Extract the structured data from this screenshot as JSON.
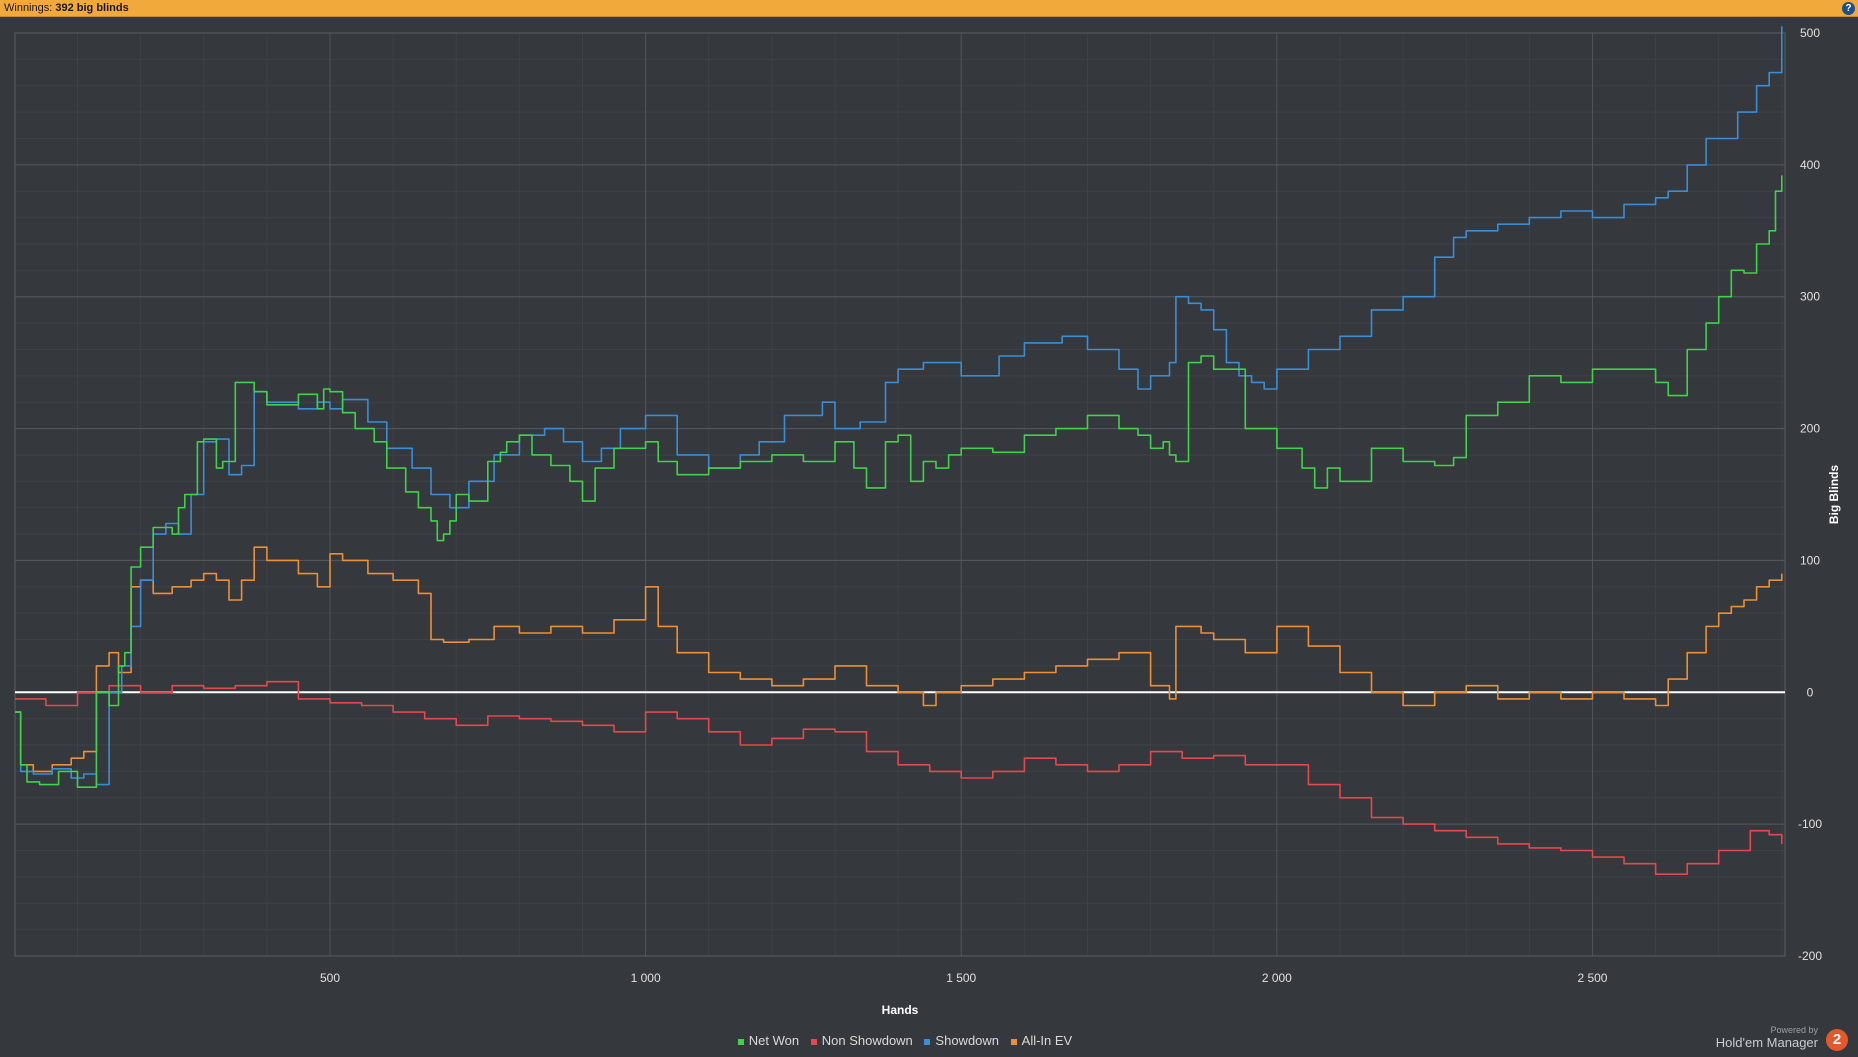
{
  "header": {
    "label": "Winnings:",
    "value": "392 big blinds",
    "help": "?"
  },
  "branding": {
    "powered": "Powered by",
    "product": "Hold'em Manager",
    "logo": "2"
  },
  "chart_data": {
    "type": "line",
    "xlabel": "Hands",
    "ylabel": "Big Blinds",
    "xlim": [
      1,
      2805
    ],
    "ylim": [
      -200,
      500
    ],
    "xticks": [
      500,
      1000,
      1500,
      2000,
      2500
    ],
    "xtick_labels": [
      "500",
      "1 000",
      "1 500",
      "2 000",
      "2 500"
    ],
    "yticks": [
      -200,
      -100,
      0,
      100,
      200,
      300,
      400,
      500
    ],
    "grid": true,
    "legend": "bottom-center",
    "series": [
      {
        "name": "Net Won",
        "color": "#3fd24a",
        "x": [
          1,
          10,
          20,
          40,
          70,
          100,
          130,
          150,
          165,
          175,
          185,
          200,
          220,
          250,
          260,
          270,
          290,
          300,
          320,
          330,
          350,
          380,
          400,
          450,
          480,
          490,
          500,
          520,
          540,
          570,
          590,
          620,
          640,
          660,
          670,
          680,
          690,
          700,
          720,
          750,
          770,
          780,
          800,
          820,
          850,
          880,
          900,
          920,
          950,
          1000,
          1020,
          1050,
          1100,
          1150,
          1200,
          1250,
          1300,
          1330,
          1350,
          1380,
          1400,
          1420,
          1440,
          1460,
          1480,
          1500,
          1550,
          1600,
          1650,
          1700,
          1750,
          1780,
          1800,
          1820,
          1830,
          1840,
          1860,
          1880,
          1900,
          1950,
          2000,
          2040,
          2060,
          2080,
          2100,
          2150,
          2200,
          2250,
          2280,
          2300,
          2350,
          2400,
          2450,
          2500,
          2550,
          2600,
          2620,
          2650,
          2680,
          2700,
          2720,
          2740,
          2760,
          2780,
          2790,
          2800
        ],
        "y": [
          -15,
          -55,
          -68,
          -70,
          -60,
          -72,
          0,
          -10,
          20,
          30,
          95,
          110,
          125,
          120,
          140,
          150,
          190,
          192,
          170,
          175,
          235,
          228,
          218,
          226,
          215,
          230,
          228,
          212,
          200,
          190,
          170,
          152,
          140,
          130,
          115,
          120,
          130,
          150,
          145,
          175,
          182,
          190,
          195,
          180,
          172,
          160,
          145,
          170,
          185,
          190,
          175,
          165,
          170,
          175,
          180,
          175,
          190,
          170,
          155,
          190,
          195,
          160,
          175,
          170,
          180,
          185,
          182,
          195,
          200,
          210,
          200,
          195,
          185,
          190,
          180,
          175,
          250,
          255,
          245,
          200,
          185,
          170,
          155,
          170,
          160,
          185,
          175,
          172,
          178,
          210,
          220,
          240,
          235,
          245,
          245,
          235,
          225,
          260,
          280,
          300,
          320,
          318,
          340,
          350,
          380,
          392
        ]
      },
      {
        "name": "Non Showdown",
        "color": "#e5484d",
        "x": [
          1,
          50,
          100,
          150,
          200,
          250,
          300,
          350,
          400,
          450,
          500,
          550,
          600,
          650,
          700,
          750,
          800,
          850,
          900,
          950,
          1000,
          1050,
          1100,
          1150,
          1200,
          1250,
          1300,
          1350,
          1400,
          1450,
          1500,
          1550,
          1600,
          1650,
          1700,
          1750,
          1800,
          1850,
          1900,
          1950,
          2000,
          2050,
          2100,
          2150,
          2200,
          2250,
          2300,
          2350,
          2400,
          2450,
          2500,
          2550,
          2600,
          2650,
          2700,
          2750,
          2780,
          2800
        ],
        "y": [
          -5,
          -10,
          0,
          5,
          0,
          5,
          3,
          5,
          8,
          -5,
          -8,
          -10,
          -15,
          -20,
          -25,
          -18,
          -20,
          -22,
          -25,
          -30,
          -15,
          -20,
          -30,
          -40,
          -35,
          -28,
          -30,
          -45,
          -55,
          -60,
          -65,
          -60,
          -50,
          -55,
          -60,
          -55,
          -45,
          -50,
          -48,
          -55,
          -55,
          -70,
          -80,
          -95,
          -100,
          -105,
          -110,
          -115,
          -118,
          -120,
          -125,
          -130,
          -138,
          -130,
          -120,
          -105,
          -108,
          -115
        ]
      },
      {
        "name": "Showdown",
        "color": "#3a8ed6",
        "x": [
          1,
          10,
          30,
          60,
          90,
          110,
          130,
          150,
          170,
          185,
          200,
          220,
          240,
          260,
          280,
          300,
          320,
          340,
          360,
          380,
          400,
          450,
          480,
          500,
          520,
          560,
          590,
          630,
          660,
          690,
          720,
          760,
          800,
          840,
          870,
          900,
          930,
          960,
          1000,
          1050,
          1100,
          1150,
          1180,
          1220,
          1280,
          1300,
          1340,
          1380,
          1400,
          1440,
          1500,
          1560,
          1600,
          1660,
          1700,
          1750,
          1780,
          1800,
          1830,
          1840,
          1860,
          1880,
          1900,
          1920,
          1940,
          1960,
          1980,
          2000,
          2050,
          2080,
          2100,
          2150,
          2200,
          2250,
          2280,
          2300,
          2350,
          2400,
          2450,
          2500,
          2550,
          2600,
          2620,
          2650,
          2680,
          2700,
          2730,
          2760,
          2780,
          2800
        ],
        "y": [
          -15,
          -60,
          -62,
          -58,
          -65,
          -62,
          -70,
          0,
          20,
          50,
          85,
          120,
          128,
          120,
          150,
          190,
          192,
          165,
          172,
          228,
          220,
          215,
          220,
          215,
          222,
          205,
          185,
          170,
          150,
          140,
          160,
          180,
          195,
          200,
          190,
          175,
          185,
          200,
          210,
          180,
          170,
          180,
          190,
          210,
          220,
          200,
          205,
          235,
          245,
          250,
          240,
          255,
          265,
          270,
          260,
          245,
          230,
          240,
          250,
          300,
          295,
          290,
          275,
          250,
          240,
          235,
          230,
          245,
          260,
          260,
          270,
          290,
          300,
          330,
          345,
          350,
          355,
          360,
          365,
          360,
          370,
          375,
          380,
          400,
          420,
          420,
          440,
          460,
          470,
          505
        ]
      },
      {
        "name": "All-In EV",
        "color": "#ee8f33",
        "x": [
          1,
          10,
          30,
          60,
          90,
          110,
          130,
          150,
          165,
          185,
          200,
          220,
          250,
          280,
          300,
          320,
          340,
          360,
          380,
          400,
          450,
          480,
          500,
          520,
          560,
          600,
          640,
          660,
          680,
          720,
          760,
          800,
          850,
          900,
          950,
          1000,
          1020,
          1050,
          1100,
          1150,
          1200,
          1250,
          1300,
          1350,
          1400,
          1440,
          1460,
          1500,
          1550,
          1600,
          1650,
          1700,
          1750,
          1800,
          1830,
          1840,
          1880,
          1900,
          1950,
          2000,
          2050,
          2100,
          2150,
          2200,
          2250,
          2300,
          2350,
          2400,
          2450,
          2500,
          2550,
          2600,
          2620,
          2650,
          2680,
          2700,
          2720,
          2740,
          2760,
          2780,
          2800
        ],
        "y": [
          -15,
          -55,
          -60,
          -55,
          -50,
          -45,
          20,
          30,
          15,
          80,
          85,
          75,
          80,
          85,
          90,
          85,
          70,
          85,
          110,
          100,
          90,
          80,
          105,
          100,
          90,
          85,
          75,
          40,
          38,
          40,
          50,
          45,
          50,
          45,
          55,
          80,
          50,
          30,
          15,
          10,
          5,
          10,
          20,
          5,
          0,
          -10,
          0,
          5,
          10,
          15,
          20,
          25,
          30,
          5,
          -5,
          50,
          45,
          40,
          30,
          50,
          35,
          15,
          0,
          -10,
          0,
          5,
          -5,
          0,
          -5,
          0,
          -5,
          -10,
          10,
          30,
          50,
          60,
          65,
          70,
          80,
          85,
          90
        ]
      }
    ]
  }
}
